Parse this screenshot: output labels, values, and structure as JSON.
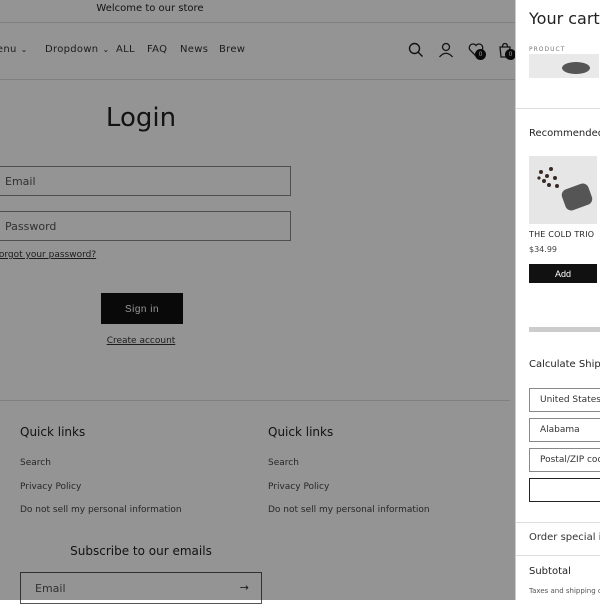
{
  "announcement": "Welcome to our store",
  "nav": {
    "items": [
      {
        "label": "Menu",
        "has_dropdown": true
      },
      {
        "label": "Dropdown",
        "has_dropdown": true
      },
      {
        "label": "ALL",
        "has_dropdown": false
      },
      {
        "label": "FAQ",
        "has_dropdown": false
      },
      {
        "label": "News",
        "has_dropdown": false
      },
      {
        "label": "Brew",
        "has_dropdown": false
      }
    ]
  },
  "header_icons": {
    "search": "search-icon",
    "account": "account-icon",
    "wishlist": {
      "icon": "heart-icon",
      "count": "0"
    },
    "cart": {
      "icon": "cart-icon",
      "count": "0"
    }
  },
  "login": {
    "title": "Login",
    "email_placeholder": "Email",
    "password_placeholder": "Password",
    "forgot": "Forgot your password?",
    "sign_in": "Sign in",
    "create_account": "Create account"
  },
  "footer": {
    "columns": [
      {
        "heading": "Quick links",
        "links": [
          "Search",
          "Privacy Policy",
          "Do not sell my personal information"
        ]
      },
      {
        "heading": "Quick links",
        "links": [
          "Search",
          "Privacy Policy",
          "Do not sell my personal information"
        ]
      }
    ],
    "subscribe_title": "Subscribe to our emails",
    "email_placeholder": "Email"
  },
  "cart": {
    "title": "Your cart",
    "product_label": "PRODUCT",
    "recommended": "Recommended",
    "recommendation": {
      "name": "THE COLD TRIO",
      "price": "$34.99",
      "add": "Add"
    },
    "calculate_shipping": "Calculate Shipping",
    "country": "United States",
    "state": "Alabama",
    "postal_placeholder": "Postal/ZIP code",
    "order_special": "Order special instructions",
    "subtotal": "Subtotal",
    "taxes": "Taxes and shipping calculated at checkout"
  },
  "colors": {
    "overlay": "#000000",
    "button": "#111111"
  }
}
